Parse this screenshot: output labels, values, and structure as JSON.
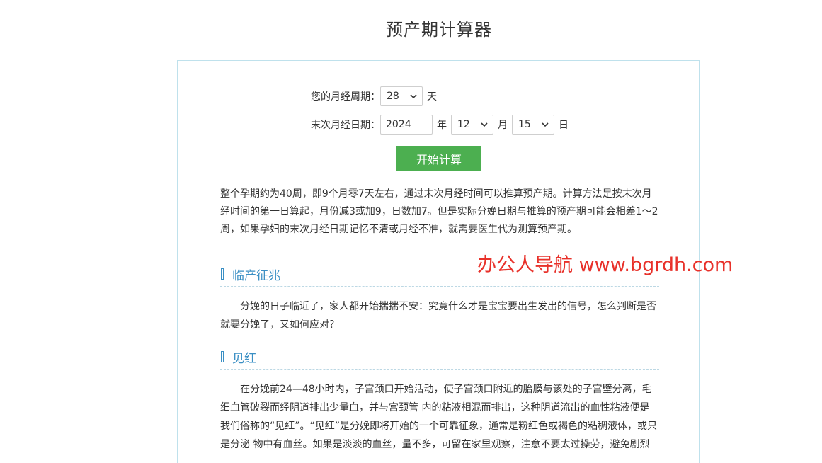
{
  "page": {
    "title": "预产期计算器"
  },
  "form": {
    "cycle_label": "您的月经周期：",
    "cycle_value": "28",
    "cycle_unit": "天",
    "date_label": "末次月经日期：",
    "year_value": "2024",
    "year_unit": "年",
    "month_value": "12",
    "month_unit": "月",
    "day_value": "15",
    "day_unit": "日",
    "start_button": "开始计算"
  },
  "intro": "整个孕期约为40周，即9个月零7天左右，通过末次月经时间可以推算预产期。计算方法是按末次月经时间的第一日算起，月份减3或加9，日数加7。但是实际分娩日期与推算的预产期可能会相差1～2周，如果孕妇的末次月经日期记忆不清或月经不准，就需要医生代为测算预产期。",
  "sections": [
    {
      "heading": "临产征兆",
      "text": "分娩的日子临近了，家人都开始揣揣不安：究竟什么才是宝宝要出生发出的信号，怎么判断是否就要分娩了，又如何应对？"
    },
    {
      "heading": "见红",
      "text": "在分娩前24—48小时内，子宫颈口开始活动，使子宫颈口附近的胎膜与该处的子宫壁分离，毛细血管破裂而经阴道排出少量血，并与宫颈管 内的粘液相混而排出，这种阴道流出的血性粘液便是我们俗称的“见红”。“见红”是分娩即将开始的一个可靠征象，通常是粉红色或褐色的粘稠液体，或只是分泌 物中有血丝。如果是淡淡的血丝，量不多，可留在家里观察，注意不要太过操劳，避免剧烈"
    }
  ],
  "watermark": "办公人导航 www.bgrdh.com",
  "colors": {
    "accent_blue": "#3a8fc4",
    "button_green": "#4caf50",
    "watermark_red": "#e8312a",
    "border": "#bfe1ec"
  }
}
